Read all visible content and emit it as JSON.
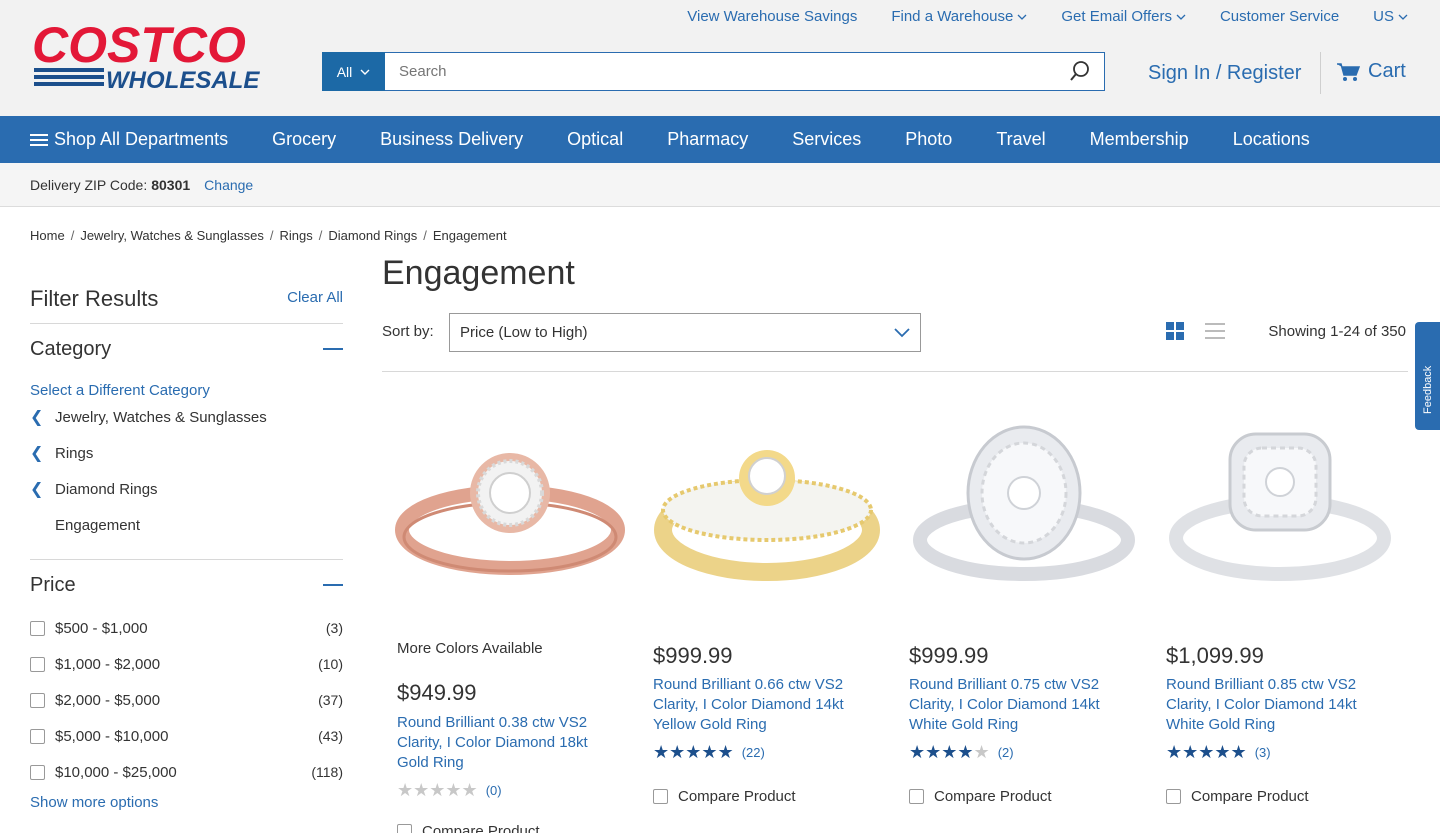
{
  "logo": {
    "line1": "COSTCO",
    "line2": "WHOLESALE"
  },
  "util_nav": [
    {
      "label": "View Warehouse Savings",
      "dropdown": false
    },
    {
      "label": "Find a Warehouse",
      "dropdown": true
    },
    {
      "label": "Get Email Offers",
      "dropdown": true
    },
    {
      "label": "Customer Service",
      "dropdown": false
    },
    {
      "label": "US",
      "dropdown": true
    }
  ],
  "search": {
    "scope": "All",
    "placeholder": "Search"
  },
  "account": {
    "signin": "Sign In / Register",
    "cart": "Cart"
  },
  "main_nav": {
    "shop_all": "Shop All Departments",
    "items": [
      "Grocery",
      "Business Delivery",
      "Optical",
      "Pharmacy",
      "Services",
      "Photo",
      "Travel",
      "Membership",
      "Locations"
    ]
  },
  "zip": {
    "label": "Delivery ZIP Code:",
    "value": "80301",
    "change": "Change"
  },
  "breadcrumb": [
    "Home",
    "Jewelry, Watches & Sunglasses",
    "Rings",
    "Diamond Rings",
    "Engagement"
  ],
  "sidebar": {
    "title": "Filter Results",
    "clear_all": "Clear All",
    "category_title": "Category",
    "select_different": "Select a Different Category",
    "categories": [
      "Jewelry, Watches & Sunglasses",
      "Rings",
      "Diamond Rings"
    ],
    "current_category": "Engagement",
    "price_title": "Price",
    "prices": [
      {
        "label": "$500 - $1,000",
        "count": "(3)"
      },
      {
        "label": "$1,000 - $2,000",
        "count": "(10)"
      },
      {
        "label": "$2,000 - $5,000",
        "count": "(37)"
      },
      {
        "label": "$5,000 - $10,000",
        "count": "(43)"
      },
      {
        "label": "$10,000 - $25,000",
        "count": "(118)"
      }
    ],
    "show_more": "Show more options"
  },
  "main": {
    "title": "Engagement",
    "sort_label": "Sort by:",
    "sort_value": "Price (Low to High)",
    "showing": "Showing 1-24 of 350",
    "feedback": "Feedback"
  },
  "products": [
    {
      "more_colors": "More Colors Available",
      "price": "$949.99",
      "name": "Round Brilliant 0.38 ctw VS2 Clarity, I Color Diamond 18kt Gold Ring",
      "rating": 0,
      "reviews": "(0)",
      "compare": "Compare Product",
      "metal": "rose"
    },
    {
      "more_colors": "",
      "price": "$999.99",
      "name": "Round Brilliant 0.66 ctw VS2 Clarity, I Color Diamond 14kt Yellow Gold Ring",
      "rating": 5,
      "reviews": "(22)",
      "compare": "Compare Product",
      "metal": "yellow"
    },
    {
      "more_colors": "",
      "price": "$999.99",
      "name": "Round Brilliant 0.75 ctw VS2 Clarity, I Color Diamond 14kt White Gold Ring",
      "rating": 4.5,
      "reviews": "(2)",
      "compare": "Compare Product",
      "metal": "white"
    },
    {
      "more_colors": "",
      "price": "$1,099.99",
      "name": "Round Brilliant 0.85 ctw VS2 Clarity, I Color Diamond 14kt White Gold Ring",
      "rating": 5,
      "reviews": "(3)",
      "compare": "Compare Product",
      "metal": "white"
    }
  ],
  "colors": {
    "brand_blue": "#2a6cb0",
    "costco_red": "#e31837",
    "star_blue": "#1c4f8c"
  }
}
